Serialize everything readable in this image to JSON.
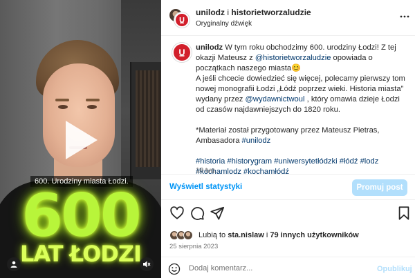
{
  "video": {
    "subtitle": "600. Urodziny miasta Łodzi.",
    "overlay_big": "600",
    "overlay_sub": "LAT ŁODZI"
  },
  "header": {
    "account": "unilodz",
    "connector": "i",
    "collaborator": "historietworzaludzie",
    "audio": "Oryginalny dźwięk"
  },
  "caption": {
    "username": "unilodz",
    "line1_a": "W tym roku obchodzimy 600. urodziny Łodzi! Z tej okazji Mateusz z ",
    "mention1": "@historietworzaludzie",
    "line1_b": " opowiada o początkach naszego miasta",
    "emoji": "😊",
    "line2_a": "A jeśli chcecie dowiedzieć się więcej, polecamy pierwszy tom nowej monografii Łodzi „Łódź poprzez wieki. Historia miasta” wydany przez ",
    "mention2": "@wydawnictwoul",
    "line2_b": " , który omawia dzieje Łodzi od czasów najdawniejszych do 1820 roku.",
    "line3": "*Materiał został przygotowany przez Mateusz Pietras, Ambasadora ",
    "tag_unilodz": "#unilodz",
    "hashtags": [
      "#historia",
      "#historygram",
      "#uniwersytetłódzki",
      "#łódź",
      "#lodz",
      "#kochamlodz",
      "#kochamłódź"
    ],
    "age": "18 tyg."
  },
  "stats": {
    "link": "Wyświetl statystyki",
    "promote": "Promuj post"
  },
  "likes": {
    "prefix": "Lubią to",
    "user": "sta.nislaw",
    "middle": "i",
    "others": "79 innych użytkowników"
  },
  "date": "25 sierpnia 2023",
  "comment": {
    "placeholder": "Dodaj komentarz...",
    "publish": "Opublikuj"
  },
  "icons": [
    "play-icon",
    "user-tag-icon",
    "mute-icon",
    "more-icon",
    "heart-icon",
    "comment-icon",
    "share-icon",
    "bookmark-icon",
    "emoji-icon",
    "unilodz-logo-icon"
  ],
  "colors": {
    "link_blue": "#0095f6",
    "promote_bg": "#b2dffc",
    "mention": "#00376b",
    "brand_red": "#d21f2b",
    "neon": "#b8f53a"
  }
}
